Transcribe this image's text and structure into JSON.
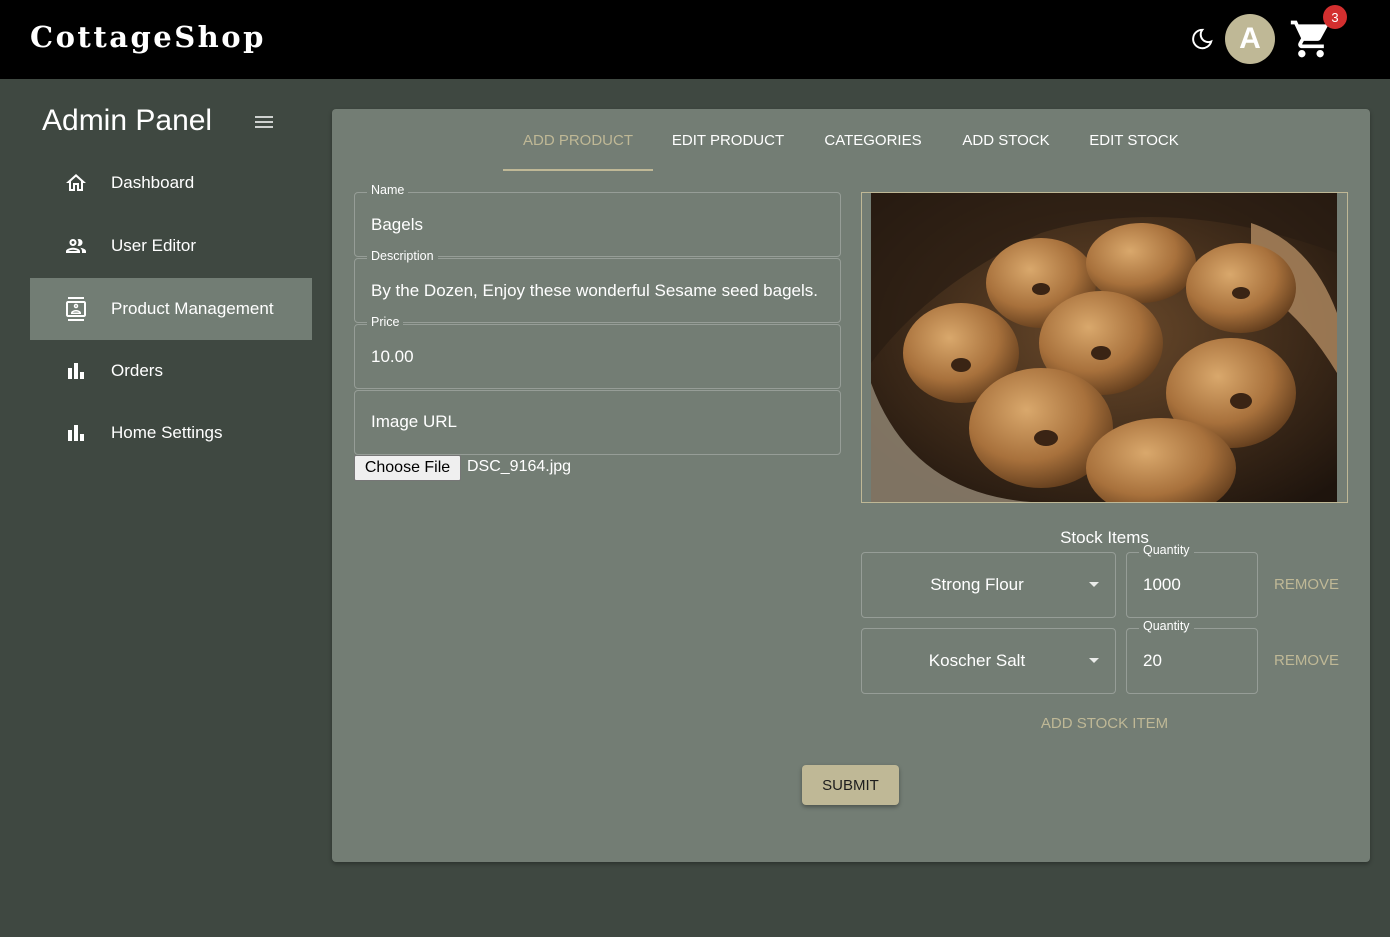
{
  "header": {
    "brand": "CottageShop",
    "avatar_letter": "A",
    "cart_count": "3",
    "theme_icon": "moon-icon",
    "cart_icon": "shopping-cart-icon"
  },
  "sidebar": {
    "title": "Admin Panel",
    "menu_icon": "hamburger-menu-icon",
    "items": [
      {
        "label": "Dashboard",
        "icon": "home-icon"
      },
      {
        "label": "User Editor",
        "icon": "users-icon"
      },
      {
        "label": "Product Management",
        "icon": "contact-card-icon",
        "active": true
      },
      {
        "label": "Orders",
        "icon": "bar-chart-icon"
      },
      {
        "label": "Home Settings",
        "icon": "bar-chart-icon"
      }
    ]
  },
  "tabs": [
    {
      "label": "ADD PRODUCT",
      "active": true
    },
    {
      "label": "EDIT PRODUCT"
    },
    {
      "label": "CATEGORIES"
    },
    {
      "label": "ADD STOCK"
    },
    {
      "label": "EDIT STOCK"
    }
  ],
  "form": {
    "name_label": "Name",
    "name_value": "Bagels",
    "description_label": "Description",
    "description_value": "By the Dozen, Enjoy these wonderful Sesame seed bagels.",
    "price_label": "Price",
    "price_value": "10.00",
    "image_url_placeholder": "Image URL",
    "choose_file_label": "Choose File",
    "file_name": "DSC_9164.jpg"
  },
  "stock": {
    "title": "Stock Items",
    "items": [
      {
        "ingredient": "Strong Flour",
        "quantity_label": "Quantity",
        "quantity": "1000",
        "remove_label": "REMOVE"
      },
      {
        "ingredient": "Koscher Salt",
        "quantity_label": "Quantity",
        "quantity": "20",
        "remove_label": "REMOVE"
      }
    ],
    "add_label": "ADD STOCK ITEM"
  },
  "submit_label": "SUBMIT",
  "colors": {
    "accent": "#bfb896",
    "panel": "#737d74",
    "background": "#3f4841",
    "topbar": "#000000",
    "badge": "#d32f2f"
  }
}
